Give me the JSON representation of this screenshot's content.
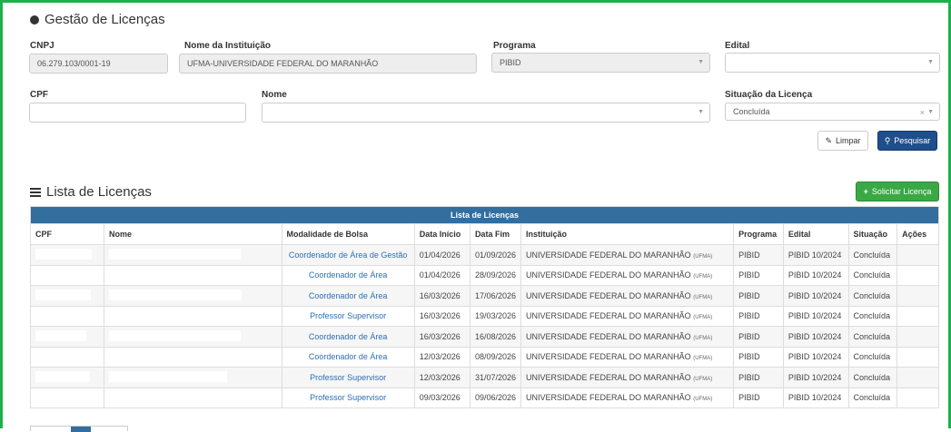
{
  "header": {
    "title": "Gestão de Licenças"
  },
  "filters": {
    "cnpj_label": "CNPJ",
    "cnpj_value": "06.279.103/0001-19",
    "instituicao_label": "Nome da Instituição",
    "instituicao_value": "UFMA-UNIVERSIDADE FEDERAL DO MARANHÃO",
    "programa_label": "Programa",
    "programa_value": "PIBID",
    "edital_label": "Edital",
    "edital_value": "",
    "cpf_label": "CPF",
    "cpf_value": "",
    "nome_label": "Nome",
    "nome_value": "",
    "situacao_label": "Situação da Licença",
    "situacao_value": "Concluída"
  },
  "actions": {
    "limpar": "Limpar",
    "pesquisar": "Pesquisar",
    "solicitar": "Solicitar Licença"
  },
  "list": {
    "title": "Lista de Licenças",
    "caption": "Lista de Licenças",
    "columns": [
      "CPF",
      "Nome",
      "Modalidade de Bolsa",
      "Data Início",
      "Data Fim",
      "Instituição",
      "Programa",
      "Edital",
      "Situação",
      "Ações"
    ],
    "rows": [
      {
        "cpf": "",
        "nome": "",
        "modalidade": "Coordenador de Área de Gestão",
        "inicio": "01/04/2026",
        "fim": "01/09/2026",
        "inst": "UNIVERSIDADE FEDERAL DO MARANHÃO",
        "sigla": "(UFMA)",
        "programa": "PIBID",
        "edital": "PIBID 10/2024",
        "situacao": "Concluída"
      },
      {
        "cpf": "",
        "nome": "",
        "modalidade": "Coordenador de Área",
        "inicio": "01/04/2026",
        "fim": "28/09/2026",
        "inst": "UNIVERSIDADE FEDERAL DO MARANHÃO",
        "sigla": "(UFMA)",
        "programa": "PIBID",
        "edital": "PIBID 10/2024",
        "situacao": "Concluída"
      },
      {
        "cpf": "",
        "nome": "",
        "modalidade": "Coordenador de Área",
        "inicio": "16/03/2026",
        "fim": "17/06/2026",
        "inst": "UNIVERSIDADE FEDERAL DO MARANHÃO",
        "sigla": "(UFMA)",
        "programa": "PIBID",
        "edital": "PIBID 10/2024",
        "situacao": "Concluída"
      },
      {
        "cpf": "",
        "nome": "",
        "modalidade": "Professor Supervisor",
        "inicio": "16/03/2026",
        "fim": "19/03/2026",
        "inst": "UNIVERSIDADE FEDERAL DO MARANHÃO",
        "sigla": "(UFMA)",
        "programa": "PIBID",
        "edital": "PIBID 10/2024",
        "situacao": "Concluída"
      },
      {
        "cpf": "",
        "nome": "",
        "modalidade": "Coordenador de Área",
        "inicio": "16/03/2026",
        "fim": "16/08/2026",
        "inst": "UNIVERSIDADE FEDERAL DO MARANHÃO",
        "sigla": "(UFMA)",
        "programa": "PIBID",
        "edital": "PIBID 10/2024",
        "situacao": "Concluída"
      },
      {
        "cpf": "",
        "nome": "",
        "modalidade": "Coordenador de Área",
        "inicio": "12/03/2026",
        "fim": "08/09/2026",
        "inst": "UNIVERSIDADE FEDERAL DO MARANHÃO",
        "sigla": "(UFMA)",
        "programa": "PIBID",
        "edital": "PIBID 10/2024",
        "situacao": "Concluída"
      },
      {
        "cpf": "",
        "nome": "",
        "modalidade": "Professor Supervisor",
        "inicio": "12/03/2026",
        "fim": "31/07/2026",
        "inst": "UNIVERSIDADE FEDERAL DO MARANHÃO",
        "sigla": "(UFMA)",
        "programa": "PIBID",
        "edital": "PIBID 10/2024",
        "situacao": "Concluída"
      },
      {
        "cpf": "",
        "nome": "",
        "modalidade": "Professor Supervisor",
        "inicio": "09/03/2026",
        "fim": "09/06/2026",
        "inst": "UNIVERSIDADE FEDERAL DO MARANHÃO",
        "sigla": "(UFMA)",
        "programa": "PIBID",
        "edital": "PIBID 10/2024",
        "situacao": "Concluída"
      }
    ]
  },
  "colors": {
    "accent_border": "#1fb04a",
    "table_header": "#336e9e",
    "primary": "#1f4e8c",
    "success": "#3aa845",
    "link": "#2c6fb4"
  },
  "icons": {
    "header": "circle-bullet-icon",
    "list": "list-icon",
    "clear": "eraser-icon",
    "search": "search-icon",
    "add": "plus-icon"
  }
}
